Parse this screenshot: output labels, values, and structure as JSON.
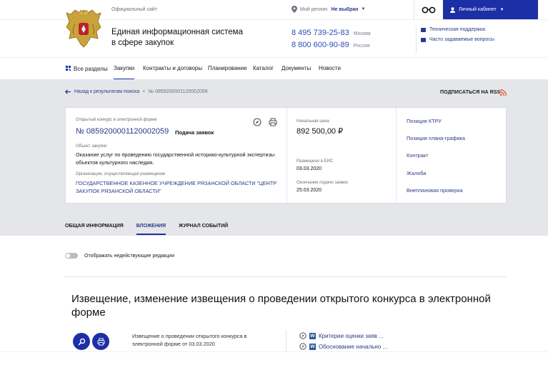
{
  "topbar": {
    "official": "Официальный сайт",
    "region_label": "Мой регион:",
    "region_value": "Не выбран",
    "cabinet": "Личный кабинет"
  },
  "header": {
    "title_line1": "Единая информационная система",
    "title_line2": "в сфере закупок",
    "phones": [
      {
        "number": "8 495 739-25-83",
        "label": "Москва"
      },
      {
        "number": "8 800 600-90-89",
        "label": "Россия"
      }
    ],
    "help": [
      "Техническая поддержка",
      "Часто задаваемые вопросы"
    ]
  },
  "nav": {
    "items": [
      "Все разделы",
      "Закупки",
      "Контракты и договоры",
      "Планирование",
      "Каталог",
      "Документы",
      "Новости"
    ]
  },
  "breadcrumb": {
    "back": "Назад к результатам поиска",
    "current": "№ 0859200001120002059"
  },
  "rss": "ПОДПИСАТЬСЯ НА RSS",
  "card": {
    "type": "Открытый конкурс в электронной форме",
    "number": "№ 0859200001120002059",
    "stage": "Подача заявок",
    "object_label": "Объект закупки",
    "object": "Оказание услуг по проведению государственной историко-культурной экспертизы объектов культурного наследия.",
    "org_label": "Организация, осуществляющая размещение",
    "org": "ГОСУДАРСТВЕННОЕ КАЗЕННОЕ УЧРЕЖДЕНИЕ РЯЗАНСКОЙ ОБЛАСТИ \"ЦЕНТР ЗАКУПОК РЯЗАНСКОЙ ОБЛАСТИ\"",
    "price_label": "Начальная цена",
    "price": "892 500,00 ₽",
    "placed_label": "Размещено в ЕИС",
    "placed": "03.03.2020",
    "deadline_label": "Окончание подачи заявок",
    "deadline": "25.03.2020",
    "links": [
      "Позиция КТРУ",
      "Позиция плана-графика",
      "Контракт",
      "Жалоба",
      "Внеплановая проверка"
    ]
  },
  "tabs": [
    "ОБЩАЯ ИНФОРМАЦИЯ",
    "ВЛОЖЕНИЯ",
    "ЖУРНАЛ СОБЫТИЙ"
  ],
  "toggle_label": "Отображать недействующие редакции",
  "section_title": "Извещение, изменение извещения о проведении открытого конкурса в электронной форме",
  "doc": {
    "line1": "Извещение о проведении открытого конкурса в",
    "line2": "электронной форме от 03.03.2020"
  },
  "files": [
    "Критерии оценки заяв ...",
    "Обоснование начально ..."
  ],
  "colors": {
    "primary": "#1d2fa6",
    "link": "#2a3a8a",
    "grey_bg": "#e5e6ea",
    "rss": "#e8542a"
  }
}
